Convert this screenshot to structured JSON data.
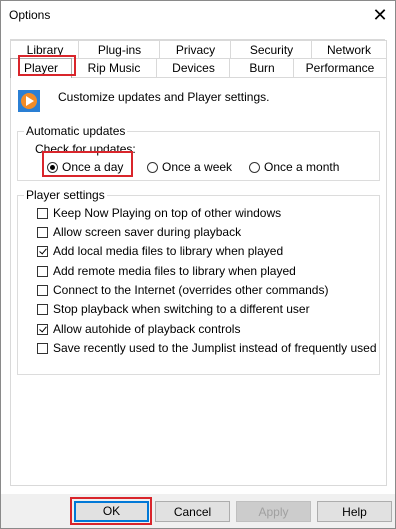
{
  "window": {
    "title": "Options",
    "close_glyph": "✕"
  },
  "tabs_back": [
    "Library",
    "Plug-ins",
    "Privacy",
    "Security",
    "Network"
  ],
  "tabs_front": [
    "Player",
    "Rip Music",
    "Devices",
    "Burn",
    "Performance"
  ],
  "active_tab": "Player",
  "intro": {
    "icon": "media-player-icon",
    "text": "Customize updates and Player settings."
  },
  "updates": {
    "group_label": "Automatic updates",
    "check_label": "Check for updates:",
    "options": [
      "Once a day",
      "Once a week",
      "Once a month"
    ],
    "selected": "Once a day"
  },
  "player_settings": {
    "group_label": "Player settings",
    "items": [
      {
        "label": "Keep Now Playing on top of other windows",
        "checked": false
      },
      {
        "label": "Allow screen saver during playback",
        "checked": false
      },
      {
        "label": "Add local media files to library when played",
        "checked": true
      },
      {
        "label": "Add remote media files to library when played",
        "checked": false
      },
      {
        "label": "Connect to the Internet (overrides other commands)",
        "checked": false
      },
      {
        "label": "Stop playback when switching to a different user",
        "checked": false
      },
      {
        "label": "Allow autohide of playback controls",
        "checked": true
      },
      {
        "label": "Save recently used to the Jumplist instead of frequently used",
        "checked": false
      }
    ]
  },
  "buttons": {
    "ok": "OK",
    "cancel": "Cancel",
    "apply": "Apply",
    "help": "Help"
  },
  "colors": {
    "highlight": "#d9252b",
    "icon_orange": "#f28c28",
    "icon_blue": "#2a7fd4"
  }
}
